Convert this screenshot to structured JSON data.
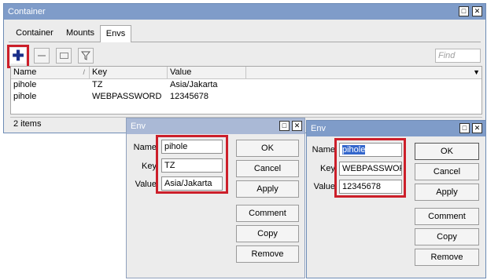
{
  "container_window": {
    "title": "Container",
    "tabs": [
      {
        "label": "Container"
      },
      {
        "label": "Mounts"
      },
      {
        "label": "Envs"
      }
    ],
    "find_placeholder": "Find",
    "columns": [
      "Name",
      "Key",
      "Value"
    ],
    "rows": [
      {
        "name": "pihole",
        "key": "TZ",
        "value": "Asia/Jakarta"
      },
      {
        "name": "pihole",
        "key": "WEBPASSWORD",
        "value": "12345678"
      }
    ],
    "status": "2 items"
  },
  "env_dialog_1": {
    "title": "Env",
    "labels": {
      "name": "Name",
      "key": "Key",
      "value": "Value"
    },
    "values": {
      "name": "pihole",
      "key": "TZ",
      "value": "Asia/Jakarta"
    },
    "buttons": {
      "ok": "OK",
      "cancel": "Cancel",
      "apply": "Apply",
      "comment": "Comment",
      "copy": "Copy",
      "remove": "Remove"
    }
  },
  "env_dialog_2": {
    "title": "Env",
    "labels": {
      "name": "Name",
      "key": "Key",
      "value": "Value"
    },
    "values": {
      "name": "pihole",
      "key": "WEBPASSWOF",
      "value": "12345678"
    },
    "buttons": {
      "ok": "OK",
      "cancel": "Cancel",
      "apply": "Apply",
      "comment": "Comment",
      "copy": "Copy",
      "remove": "Remove"
    }
  },
  "colors": {
    "titlebar": "#7f9cc9",
    "dialog_titlebar": "#aab9d6",
    "highlight": "#cc1f2a",
    "selection": "#3366cc"
  },
  "icons": [
    "add-icon",
    "remove-icon",
    "comment-icon",
    "filter-icon",
    "sort-arrow-icon",
    "dropdown-arrow-icon",
    "maximize-icon",
    "close-icon"
  ]
}
